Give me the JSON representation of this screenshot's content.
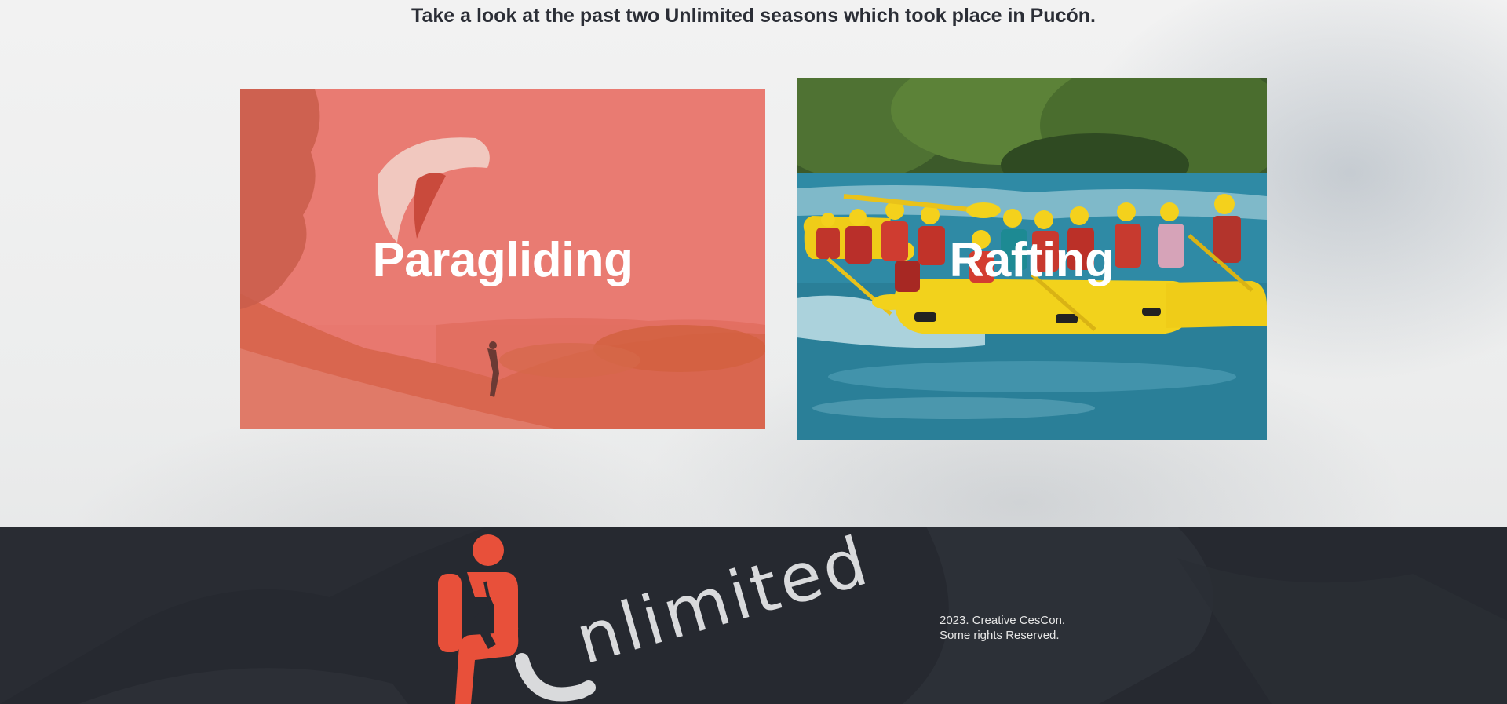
{
  "section": {
    "headline": "Take a look at the past two Unlimited seasons which took place in Pucón."
  },
  "cards": [
    {
      "title": "Paragliding",
      "overlay_color": "#e7766d"
    },
    {
      "title": "Rafting",
      "overlay_color": "#3f8aa0"
    }
  ],
  "footer": {
    "logo_text": "Unlimited",
    "logo_color": "#e8503a",
    "copyright_line1": "2023. Creative CesCon.",
    "copyright_line2": "Some rights Reserved."
  }
}
